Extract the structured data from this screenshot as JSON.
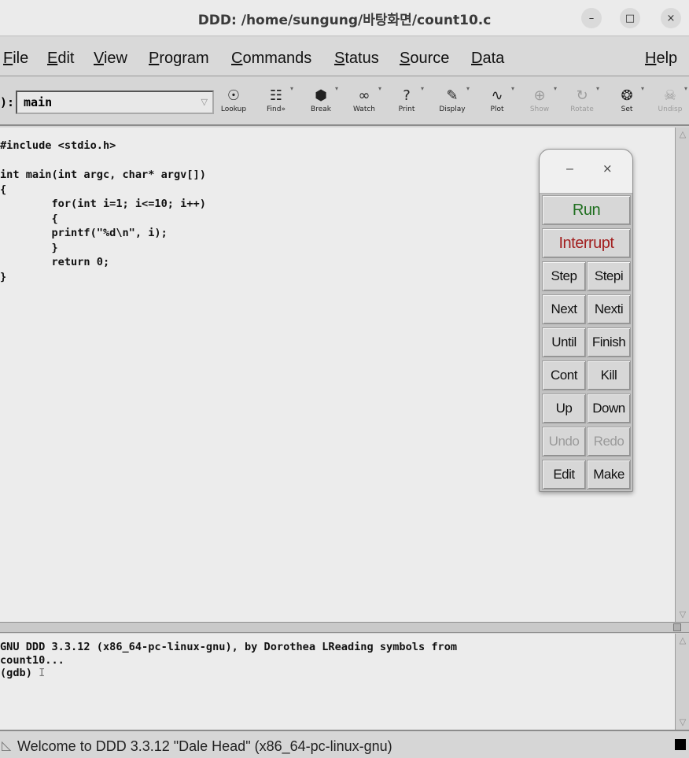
{
  "window": {
    "title": "DDD: /home/sungung/바탕화면/count10.c",
    "buttons": {
      "minimize": "–",
      "maximize": "□",
      "close": "×"
    }
  },
  "menubar": [
    {
      "first": "F",
      "rest": "ile"
    },
    {
      "first": "E",
      "rest": "dit"
    },
    {
      "first": "V",
      "rest": "iew"
    },
    {
      "first": "P",
      "rest": "rogram"
    },
    {
      "first": "C",
      "rest": "ommands"
    },
    {
      "first": "S",
      "rest": "tatus"
    },
    {
      "first": "S",
      "rest": "ource"
    },
    {
      "first": "D",
      "rest": "ata"
    },
    {
      "first": "H",
      "rest": "elp"
    }
  ],
  "toolbar": {
    "arg_prefix": "):",
    "arg_value": "main",
    "buttons": [
      {
        "label": "Lookup",
        "icon": "lookup-icon",
        "glyph": "☉"
      },
      {
        "label": "Find»",
        "icon": "binoculars-icon",
        "glyph": "☷"
      },
      {
        "label": "Break",
        "icon": "stop-sign-icon",
        "glyph": "⬢"
      },
      {
        "label": "Watch",
        "icon": "glasses-icon",
        "glyph": "∞"
      },
      {
        "label": "Print",
        "icon": "question-icon",
        "glyph": "?"
      },
      {
        "label": "Display",
        "icon": "display-icon",
        "glyph": "✎"
      },
      {
        "label": "Plot",
        "icon": "plot-icon",
        "glyph": "∿"
      },
      {
        "label": "Show",
        "icon": "magnifier-icon",
        "glyph": "⊕"
      },
      {
        "label": "Rotate",
        "icon": "rotate-icon",
        "glyph": "↻"
      },
      {
        "label": "Set",
        "icon": "set-icon",
        "glyph": "❂"
      },
      {
        "label": "Undisp",
        "icon": "undisplay-icon",
        "glyph": "☠"
      }
    ]
  },
  "source": {
    "lines": [
      "#include <stdio.h>",
      "",
      "int main(int argc, char* argv[])",
      "{",
      "        for(int i=1; i<=10; i++)",
      "        {",
      "        printf(\"%d\\n\", i);",
      "        }",
      "        return 0;",
      "}"
    ]
  },
  "console": {
    "lines": [
      "GNU DDD 3.3.12 (x86_64-pc-linux-gnu), by Dorothea LReading symbols from",
      "count10...",
      "(gdb) "
    ]
  },
  "status": {
    "message": "Welcome to DDD 3.3.12 \"Dale Head\" (x86_64-pc-linux-gnu)"
  },
  "command_tool": {
    "header": {
      "minimize": "–",
      "close": "×"
    },
    "run": "Run",
    "interrupt": "Interrupt",
    "buttons": [
      [
        "Step",
        "Stepi"
      ],
      [
        "Next",
        "Nexti"
      ],
      [
        "Until",
        "Finish"
      ],
      [
        "Cont",
        "Kill"
      ],
      [
        "Up",
        "Down"
      ],
      [
        "Undo",
        "Redo"
      ],
      [
        "Edit",
        "Make"
      ]
    ],
    "disabled": [
      "Undo",
      "Redo"
    ]
  }
}
